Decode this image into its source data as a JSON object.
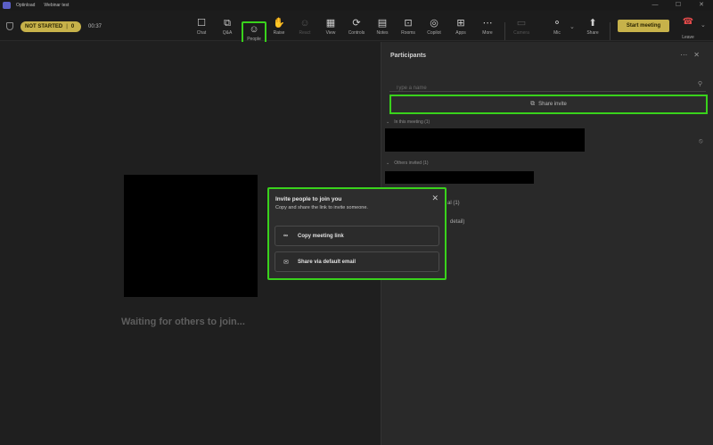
{
  "window": {
    "org": "Optinload",
    "title": "Webinar test",
    "controls": [
      "—",
      "☐",
      "✕"
    ]
  },
  "toolbar": {
    "status": "NOT STARTED",
    "status_count": "0",
    "timer": "00:37",
    "tools": [
      {
        "label": "Chat",
        "icon": "chat-icon",
        "glyph": "☐"
      },
      {
        "label": "Q&A",
        "icon": "qa-icon",
        "glyph": "⧉"
      },
      {
        "label": "People",
        "icon": "people-icon",
        "glyph": "☺"
      },
      {
        "label": "Raise",
        "icon": "raise-hand-icon",
        "glyph": "✋"
      },
      {
        "label": "React",
        "icon": "react-icon",
        "glyph": "☺"
      },
      {
        "label": "View",
        "icon": "view-icon",
        "glyph": "▦"
      },
      {
        "label": "Controls",
        "icon": "controls-icon",
        "glyph": "⟳"
      },
      {
        "label": "Notes",
        "icon": "notes-icon",
        "glyph": "▤"
      },
      {
        "label": "Rooms",
        "icon": "rooms-icon",
        "glyph": "⊡"
      },
      {
        "label": "Copilot",
        "icon": "copilot-icon",
        "glyph": "◎"
      },
      {
        "label": "Apps",
        "icon": "apps-icon",
        "glyph": "⊞"
      },
      {
        "label": "More",
        "icon": "more-icon",
        "glyph": "⋯"
      },
      {
        "label": "Camera",
        "icon": "camera-icon",
        "glyph": "▭"
      },
      {
        "label": "Mic",
        "icon": "mic-icon",
        "glyph": "⚬"
      },
      {
        "label": "Share",
        "icon": "share-icon",
        "glyph": "⬆"
      }
    ],
    "start_label": "Start meeting",
    "leave_label": "Leave"
  },
  "stage": {
    "waiting_text": "Waiting for others to join..."
  },
  "participants": {
    "title": "Participants",
    "search_placeholder": "Type a name",
    "share_invite_label": "Share invite",
    "in_meeting_label": "In this meeting (1)",
    "others_invited_label": "Others invited (1)",
    "fragment_count": "al (1)",
    "fragment_email": "detail)"
  },
  "invite_popup": {
    "title": "Invite people to join you",
    "subtitle": "Copy and share the link to invite someone.",
    "copy_label": "Copy meeting link",
    "email_label": "Share via default email"
  },
  "colors": {
    "highlight": "#39d21c",
    "accent": "#c7b24a",
    "leave": "#e34a4a"
  }
}
